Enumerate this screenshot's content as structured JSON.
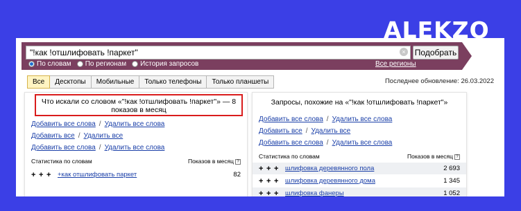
{
  "brand": "ALEKZO",
  "search": {
    "query": "\"!как !отшлифовать !паркет\"",
    "button": "Подобрать",
    "clear": "×",
    "modes": [
      "По словам",
      "По регионам",
      "История запросов"
    ],
    "regions_link": "Все регионы"
  },
  "tabs": [
    "Все",
    "Десктопы",
    "Мобильные",
    "Только телефоны",
    "Только планшеты"
  ],
  "updated": "Последнее обновление: 26.03.2022",
  "left": {
    "title": "Что искали со словом «\"!как !отшлифовать !паркет\"» — 8 показов в месяц",
    "actions": [
      {
        "add": "Добавить все слова",
        "remove": "Удалить все слова"
      },
      {
        "add": "Добавить все",
        "remove": "Удалить все"
      },
      {
        "add": "Добавить все слова",
        "remove": "Удалить все слова"
      }
    ],
    "stats_label": "Статистика по словам",
    "shows_label": "Показов в месяц",
    "rows": [
      {
        "phrase": "+как отшлифовать паркет",
        "count": "82"
      }
    ]
  },
  "right": {
    "title": "Запросы, похожие на «\"!как !отшлифовать !паркет\"»",
    "actions": [
      {
        "add": "Добавить все слова",
        "remove": "Удалить все слова"
      },
      {
        "add": "Добавить все",
        "remove": "Удалить все"
      },
      {
        "add": "Добавить все слова",
        "remove": "Удалить все слова"
      }
    ],
    "stats_label": "Статистика по словам",
    "shows_label": "Показов в месяц",
    "rows": [
      {
        "phrase": "шлифовка деревянного пола",
        "count": "2 693"
      },
      {
        "phrase": "шлифовка деревянного дома",
        "count": "1 345"
      },
      {
        "phrase": "шлифовка фанеры",
        "count": "1 052"
      }
    ]
  },
  "colors": {
    "background": "#3b3fe6",
    "searchbar": "#7b3f5f",
    "highlight": "#d91c1c",
    "link": "#1a3fa8"
  }
}
